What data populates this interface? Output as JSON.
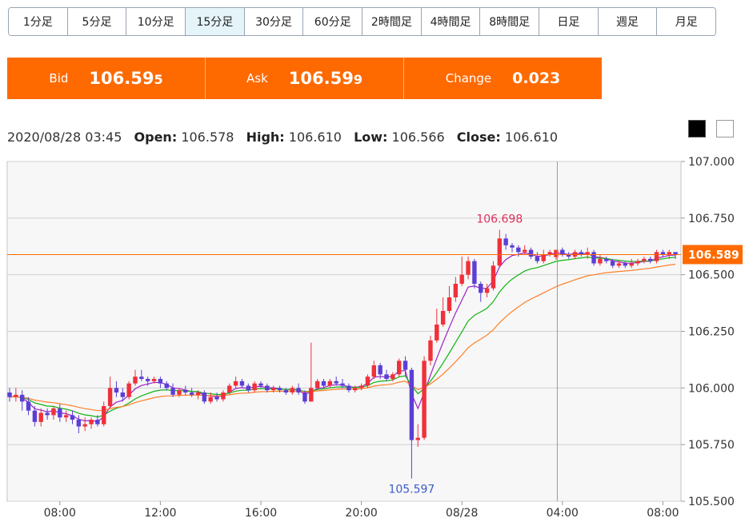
{
  "timeframes": [
    {
      "label": "1分足",
      "active": false
    },
    {
      "label": "5分足",
      "active": false
    },
    {
      "label": "10分足",
      "active": false
    },
    {
      "label": "15分足",
      "active": true
    },
    {
      "label": "30分足",
      "active": false
    },
    {
      "label": "60分足",
      "active": false
    },
    {
      "label": "2時間足",
      "active": false
    },
    {
      "label": "4時間足",
      "active": false
    },
    {
      "label": "8時間足",
      "active": false
    },
    {
      "label": "日足",
      "active": false
    },
    {
      "label": "週足",
      "active": false
    },
    {
      "label": "月足",
      "active": false
    }
  ],
  "quotes": {
    "bid": {
      "label": "Bid",
      "value_main": "106.59",
      "value_tail": "5"
    },
    "ask": {
      "label": "Ask",
      "value_main": "106.59",
      "value_tail": "9"
    },
    "change": {
      "label": "Change",
      "value": "0.023"
    }
  },
  "ohlc": {
    "datetime": "2020/08/28 03:45",
    "open_label": "Open:",
    "open": "106.578",
    "high_label": "High:",
    "high": "106.610",
    "low_label": "Low:",
    "low": "106.566",
    "close_label": "Close:",
    "close": "106.610"
  },
  "colors": {
    "accent": "#ff6a00",
    "up": "#f0303a",
    "down": "#5b3fd6",
    "ma_fast": "#a020c8",
    "ma_mid": "#12b312",
    "ma_slow": "#ff7f27",
    "high_label": "#e0305a",
    "low_label": "#3a5cc8",
    "crosshair": "#9a9a9a"
  },
  "chart_data": {
    "type": "candlestick",
    "ylim": [
      105.5,
      107.0
    ],
    "yticks": [
      "107.000",
      "106.750",
      "106.500",
      "106.250",
      "106.000",
      "105.750",
      "105.500"
    ],
    "xticks": [
      {
        "label": "08:00",
        "i": 8
      },
      {
        "label": "12:00",
        "i": 24
      },
      {
        "label": "16:00",
        "i": 40
      },
      {
        "label": "20:00",
        "i": 56
      },
      {
        "label": "08/28",
        "i": 72
      },
      {
        "label": "04:00",
        "i": 88
      },
      {
        "label": "08:00",
        "i": 104
      }
    ],
    "current_price": "106.589",
    "crosshair_index": 87,
    "annotations": [
      {
        "text": "106.698",
        "i": 78,
        "value": 106.698
      },
      {
        "text": "105.597",
        "i": 64,
        "value": 105.597
      }
    ],
    "candles": [
      [
        105.98,
        105.96,
        106.0,
        105.94
      ],
      [
        105.96,
        105.97,
        106.0,
        105.94
      ],
      [
        105.97,
        105.94,
        105.99,
        105.9
      ],
      [
        105.94,
        105.9,
        105.96,
        105.88
      ],
      [
        105.9,
        105.85,
        105.92,
        105.83
      ],
      [
        105.85,
        105.89,
        105.91,
        105.83
      ],
      [
        105.89,
        105.88,
        105.91,
        105.86
      ],
      [
        105.88,
        105.91,
        105.92,
        105.86
      ],
      [
        105.91,
        105.87,
        105.93,
        105.85
      ],
      [
        105.87,
        105.88,
        105.9,
        105.85
      ],
      [
        105.88,
        105.86,
        105.9,
        105.84
      ],
      [
        105.86,
        105.83,
        105.88,
        105.8
      ],
      [
        105.83,
        105.84,
        105.87,
        105.81
      ],
      [
        105.84,
        105.86,
        105.87,
        105.82
      ],
      [
        105.86,
        105.84,
        105.88,
        105.83
      ],
      [
        105.84,
        105.92,
        105.94,
        105.83
      ],
      [
        105.92,
        106.0,
        106.05,
        105.91
      ],
      [
        106.0,
        105.98,
        106.03,
        105.96
      ],
      [
        105.98,
        105.96,
        106.0,
        105.94
      ],
      [
        105.96,
        106.02,
        106.03,
        105.95
      ],
      [
        106.02,
        106.05,
        106.08,
        106.01
      ],
      [
        106.05,
        106.04,
        106.08,
        106.03
      ],
      [
        106.04,
        106.03,
        106.05,
        106.01
      ],
      [
        106.03,
        106.04,
        106.05,
        106.02
      ],
      [
        106.04,
        106.02,
        106.05,
        106.0
      ],
      [
        106.02,
        106.0,
        106.03,
        105.99
      ],
      [
        106.0,
        105.97,
        106.02,
        105.96
      ],
      [
        105.97,
        105.99,
        106.0,
        105.96
      ],
      [
        105.99,
        105.98,
        106.01,
        105.97
      ],
      [
        105.98,
        105.97,
        106.0,
        105.96
      ],
      [
        105.97,
        105.98,
        105.99,
        105.95
      ],
      [
        105.98,
        105.94,
        105.99,
        105.93
      ],
      [
        105.94,
        105.96,
        105.98,
        105.93
      ],
      [
        105.96,
        105.95,
        105.98,
        105.94
      ],
      [
        105.95,
        105.98,
        105.99,
        105.94
      ],
      [
        105.98,
        106.01,
        106.02,
        105.97
      ],
      [
        106.01,
        106.03,
        106.05,
        106.0
      ],
      [
        106.03,
        106.01,
        106.04,
        106.0
      ],
      [
        106.01,
        105.99,
        106.02,
        105.98
      ],
      [
        105.99,
        106.02,
        106.03,
        105.98
      ],
      [
        106.02,
        106.01,
        106.03,
        106.0
      ],
      [
        106.01,
        105.99,
        106.02,
        105.98
      ],
      [
        105.99,
        106.0,
        106.01,
        105.98
      ],
      [
        106.0,
        105.99,
        106.01,
        105.98
      ],
      [
        105.99,
        105.98,
        106.0,
        105.97
      ],
      [
        105.98,
        106.0,
        106.01,
        105.97
      ],
      [
        106.0,
        105.98,
        106.02,
        105.97
      ],
      [
        105.98,
        105.94,
        105.99,
        105.93
      ],
      [
        105.94,
        106.0,
        106.2,
        105.94
      ],
      [
        106.0,
        106.03,
        106.04,
        105.99
      ],
      [
        106.03,
        106.01,
        106.04,
        106.0
      ],
      [
        106.01,
        106.03,
        106.04,
        106.0
      ],
      [
        106.03,
        106.02,
        106.05,
        106.01
      ],
      [
        106.02,
        106.01,
        106.04,
        106.0
      ],
      [
        106.01,
        105.99,
        106.02,
        105.98
      ],
      [
        105.99,
        106.0,
        106.01,
        105.98
      ],
      [
        106.0,
        106.01,
        106.02,
        105.99
      ],
      [
        106.01,
        106.05,
        106.06,
        106.0
      ],
      [
        106.05,
        106.1,
        106.12,
        106.04
      ],
      [
        106.1,
        106.06,
        106.11,
        106.04
      ],
      [
        106.06,
        106.04,
        106.08,
        106.03
      ],
      [
        106.04,
        106.06,
        106.07,
        106.03
      ],
      [
        106.06,
        106.12,
        106.13,
        106.05
      ],
      [
        106.12,
        106.08,
        106.14,
        106.05
      ],
      [
        106.08,
        105.77,
        106.09,
        105.6
      ],
      [
        105.77,
        105.78,
        105.84,
        105.74
      ],
      [
        105.78,
        106.12,
        106.14,
        105.77
      ],
      [
        106.12,
        106.21,
        106.23,
        106.1
      ],
      [
        106.21,
        106.28,
        106.35,
        106.2
      ],
      [
        106.28,
        106.34,
        106.4,
        106.27
      ],
      [
        106.34,
        106.4,
        106.45,
        106.33
      ],
      [
        106.4,
        106.46,
        106.49,
        106.38
      ],
      [
        106.46,
        106.5,
        106.58,
        106.45
      ],
      [
        106.5,
        106.56,
        106.58,
        106.48
      ],
      [
        106.56,
        106.46,
        106.57,
        106.44
      ],
      [
        106.46,
        106.42,
        106.47,
        106.38
      ],
      [
        106.42,
        106.44,
        106.46,
        106.4
      ],
      [
        106.44,
        106.54,
        106.56,
        106.43
      ],
      [
        106.54,
        106.66,
        106.698,
        106.53
      ],
      [
        106.66,
        106.63,
        106.68,
        106.61
      ],
      [
        106.63,
        106.62,
        106.64,
        106.6
      ],
      [
        106.62,
        106.6,
        106.63,
        106.58
      ],
      [
        106.6,
        106.61,
        106.63,
        106.59
      ],
      [
        106.61,
        106.58,
        106.62,
        106.57
      ],
      [
        106.58,
        106.56,
        106.6,
        106.55
      ],
      [
        106.56,
        106.59,
        106.61,
        106.55
      ],
      [
        106.59,
        106.6,
        106.61,
        106.58
      ],
      [
        106.578,
        106.61,
        106.61,
        106.566
      ],
      [
        106.61,
        106.59,
        106.62,
        106.58
      ],
      [
        106.59,
        106.58,
        106.6,
        106.57
      ],
      [
        106.58,
        106.6,
        106.61,
        106.57
      ],
      [
        106.6,
        106.59,
        106.61,
        106.58
      ],
      [
        106.59,
        106.6,
        106.62,
        106.57
      ],
      [
        106.6,
        106.55,
        106.61,
        106.54
      ],
      [
        106.55,
        106.57,
        106.59,
        106.54
      ],
      [
        106.57,
        106.56,
        106.58,
        106.55
      ],
      [
        106.56,
        106.54,
        106.57,
        106.53
      ],
      [
        106.54,
        106.55,
        106.56,
        106.53
      ],
      [
        106.55,
        106.54,
        106.56,
        106.53
      ],
      [
        106.54,
        106.55,
        106.57,
        106.53
      ],
      [
        106.55,
        106.56,
        106.57,
        106.54
      ],
      [
        106.56,
        106.57,
        106.58,
        106.55
      ],
      [
        106.57,
        106.56,
        106.58,
        106.55
      ],
      [
        106.56,
        106.6,
        106.61,
        106.55
      ],
      [
        106.6,
        106.59,
        106.61,
        106.58
      ],
      [
        106.59,
        106.6,
        106.61,
        106.57
      ],
      [
        106.6,
        106.589,
        106.6,
        106.57
      ]
    ]
  }
}
